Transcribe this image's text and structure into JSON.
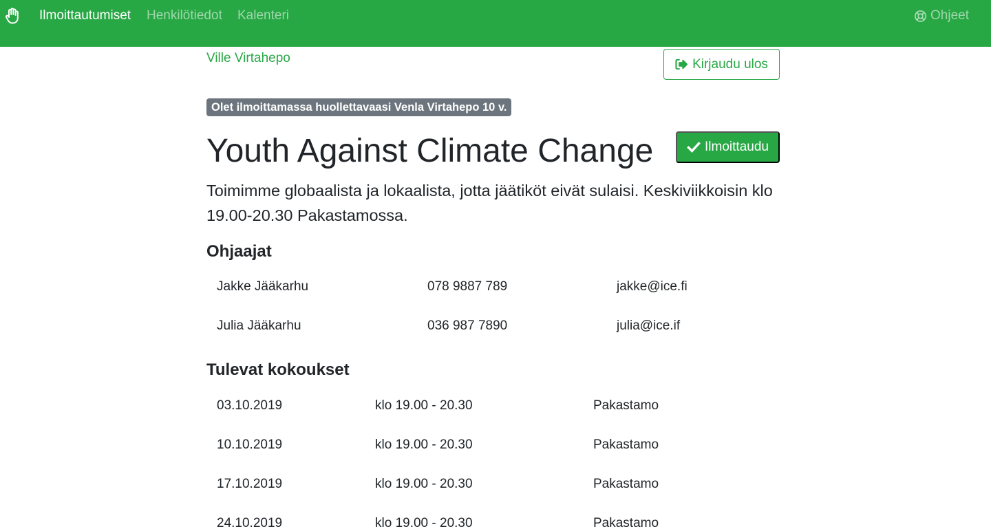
{
  "nav": {
    "items": [
      {
        "label": "Ilmoittautumiset",
        "active": true
      },
      {
        "label": "Henkilötiedot",
        "active": false
      },
      {
        "label": "Kalenteri",
        "active": false
      }
    ],
    "help_label": "Ohjeet"
  },
  "user": {
    "name": "Ville Virtahepo",
    "logout_label": "Kirjaudu ulos"
  },
  "notice": "Olet ilmoittamassa huollettavaasi Venla Virtahepo 10 v.",
  "group": {
    "title": "Youth Against Climate Change",
    "enroll_label": "Ilmoittaudu",
    "description": "Toimimme globaalista ja lokaalista, jotta jäätiköt eivät sulaisi. Keskiviikkoisin klo 19.00-20.30 Pakastamossa."
  },
  "instructors": {
    "heading": "Ohjaajat",
    "rows": [
      {
        "name": "Jakke Jääkarhu",
        "phone": "078 9887 789",
        "email": "jakke@ice.fi"
      },
      {
        "name": "Julia Jääkarhu",
        "phone": "036 987 7890",
        "email": "julia@ice.if"
      }
    ]
  },
  "meetings": {
    "heading": "Tulevat kokoukset",
    "rows": [
      {
        "date": "03.10.2019",
        "time": "klo 19.00 - 20.30",
        "place": "Pakastamo"
      },
      {
        "date": "10.10.2019",
        "time": "klo 19.00 - 20.30",
        "place": "Pakastamo"
      },
      {
        "date": "17.10.2019",
        "time": "klo 19.00 - 20.30",
        "place": "Pakastamo"
      },
      {
        "date": "24.10.2019",
        "time": "klo 19.00 - 20.30",
        "place": "Pakastamo"
      }
    ]
  },
  "colors": {
    "brand": "#28a745",
    "badge": "#6c757d",
    "text": "#212529"
  }
}
